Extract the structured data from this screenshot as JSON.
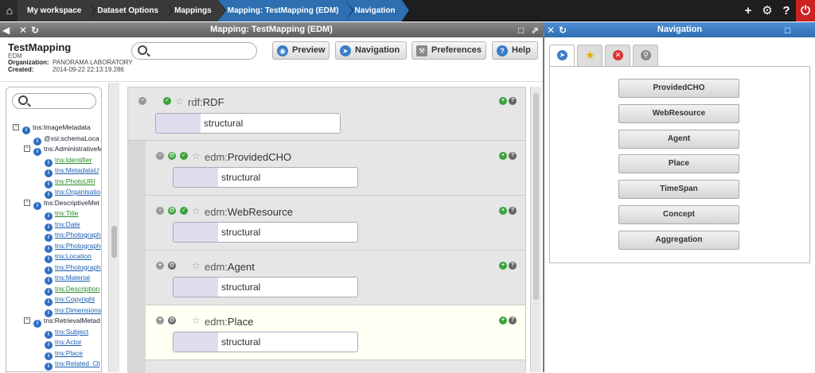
{
  "breadcrumbs": [
    "My workspace",
    "Dataset Options",
    "Mappings",
    "Mapping: TestMapping (EDM)",
    "Navigation"
  ],
  "top_icons": [
    "plus-icon",
    "gear-icon",
    "help-icon",
    "power-icon"
  ],
  "left_panel": {
    "title": "Mapping: TestMapping (EDM)",
    "mapping_name": "TestMapping",
    "schema": "EDM",
    "org_label": "Organization:",
    "org_value": "PANORAMA LABORATORY",
    "created_label": "Created:",
    "created_value": "2014-09-22 22:13:19.286",
    "buttons": [
      "Preview",
      "Navigation",
      "Preferences",
      "Help"
    ]
  },
  "tree": [
    {
      "label": "tns:ImageMetadata",
      "depth": 0,
      "toggle": "-",
      "style": "plain"
    },
    {
      "label": "@xsi:schemaLoca",
      "depth": 1,
      "toggle": "",
      "style": "plain"
    },
    {
      "label": "tns:AdministrativeM",
      "depth": 1,
      "toggle": "-",
      "style": "plain"
    },
    {
      "label": "tns:Identifier",
      "depth": 2,
      "toggle": "",
      "style": "green"
    },
    {
      "label": "tns:MetadataU",
      "depth": 2,
      "toggle": "",
      "style": "link"
    },
    {
      "label": "tns:PhotoURI",
      "depth": 2,
      "toggle": "",
      "style": "green"
    },
    {
      "label": "tns:Organisatio",
      "depth": 2,
      "toggle": "",
      "style": "link"
    },
    {
      "label": "tns:DescriptiveMet",
      "depth": 1,
      "toggle": "-",
      "style": "plain"
    },
    {
      "label": "tns:Title",
      "depth": 2,
      "toggle": "",
      "style": "green"
    },
    {
      "label": "tns:Date",
      "depth": 2,
      "toggle": "",
      "style": "link"
    },
    {
      "label": "tns:Photograph",
      "depth": 2,
      "toggle": "",
      "style": "link"
    },
    {
      "label": "tns:Photograph",
      "depth": 2,
      "toggle": "",
      "style": "link"
    },
    {
      "label": "tns:Location",
      "depth": 2,
      "toggle": "",
      "style": "link"
    },
    {
      "label": "tns:Photograph",
      "depth": 2,
      "toggle": "",
      "style": "link"
    },
    {
      "label": "tns:Material",
      "depth": 2,
      "toggle": "",
      "style": "link"
    },
    {
      "label": "tns:Description",
      "depth": 2,
      "toggle": "",
      "style": "green"
    },
    {
      "label": "tns:Copyright",
      "depth": 2,
      "toggle": "",
      "style": "link"
    },
    {
      "label": "tns:Dimensions",
      "depth": 2,
      "toggle": "",
      "style": "link"
    },
    {
      "label": "tns:RetrievalMetad",
      "depth": 1,
      "toggle": "-",
      "style": "plain"
    },
    {
      "label": "tns:Subject",
      "depth": 2,
      "toggle": "",
      "style": "link"
    },
    {
      "label": "tns:Actor",
      "depth": 2,
      "toggle": "",
      "style": "link"
    },
    {
      "label": "tns:Place",
      "depth": 2,
      "toggle": "",
      "style": "link"
    },
    {
      "label": "tns:Related_Ol",
      "depth": 2,
      "toggle": "",
      "style": "link"
    }
  ],
  "mapping_rows": [
    {
      "prefix": "rdf:",
      "name": "RDF",
      "value": "structural"
    },
    {
      "prefix": "edm:",
      "name": "ProvidedCHO",
      "value": "structural"
    },
    {
      "prefix": "edm:",
      "name": "WebResource",
      "value": "structural"
    },
    {
      "prefix": "edm:",
      "name": "Agent",
      "value": "structural"
    },
    {
      "prefix": "edm:",
      "name": "Place",
      "value": "structural"
    }
  ],
  "right_panel": {
    "title": "Navigation",
    "tabs": [
      "compass-icon",
      "star-icon",
      "remove-icon",
      "search-icon"
    ],
    "nav_buttons": [
      "ProvidedCHO",
      "WebResource",
      "Agent",
      "Place",
      "TimeSpan",
      "Concept",
      "Aggregation"
    ]
  }
}
